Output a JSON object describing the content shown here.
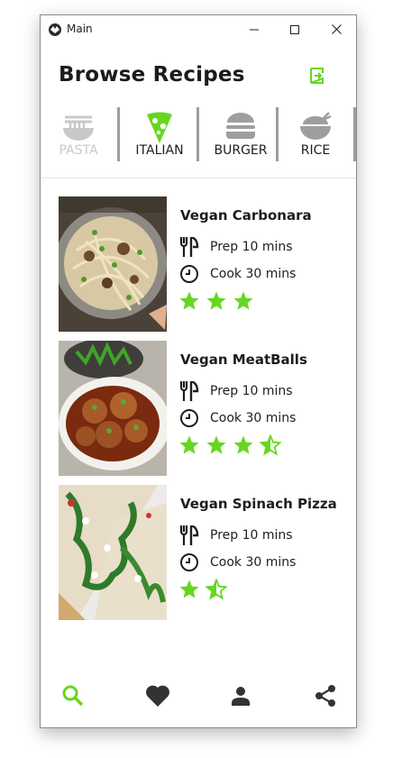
{
  "window": {
    "title": "Main"
  },
  "header": {
    "title": "Browse Recipes"
  },
  "colors": {
    "accent": "#66d620",
    "inactive": "#c8c8c8",
    "dark": "#1e1e1e"
  },
  "categories": [
    {
      "label": "PASTA",
      "icon": "noodle-bowl-icon",
      "state": "disabled"
    },
    {
      "label": "ITALIAN",
      "icon": "pizza-slice-icon",
      "state": "selected"
    },
    {
      "label": "BURGER",
      "icon": "burger-icon",
      "state": "normal"
    },
    {
      "label": "RICE",
      "icon": "rice-bowl-icon",
      "state": "normal"
    }
  ],
  "recipes": [
    {
      "name": "Vegan Carbonara",
      "prep": "Prep 10 mins",
      "cook": "Cook 30 mins",
      "rating": 3
    },
    {
      "name": "Vegan MeatBalls",
      "prep": "Prep 10 mins",
      "cook": "Cook 30 mins",
      "rating": 3.5
    },
    {
      "name": "Vegan Spinach Pizza",
      "prep": "Prep 10 mins",
      "cook": "Cook 30 mins",
      "rating": 1.5
    }
  ],
  "bottom_nav": [
    {
      "icon": "search-icon",
      "active": true
    },
    {
      "icon": "heart-icon",
      "active": false
    },
    {
      "icon": "person-icon",
      "active": false
    },
    {
      "icon": "share-icon",
      "active": false
    }
  ]
}
